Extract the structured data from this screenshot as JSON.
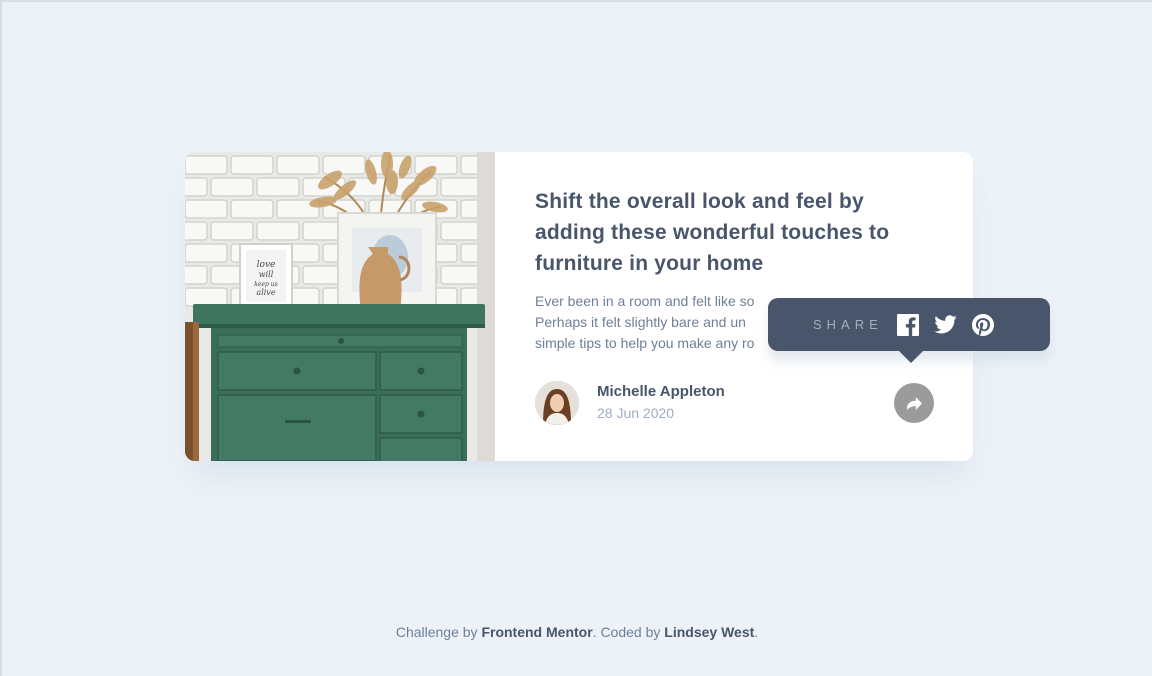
{
  "article": {
    "title": "Shift the overall look and feel by adding these wonderful touches to furniture in your home",
    "description": "Ever been in a room and felt like something was missing? Perhaps it felt slightly bare and uninviting. I’ve got some simple tips to help you make any room feel complete.",
    "description_visible": [
      "Ever been in a room and felt like so",
      "Perhaps it felt slightly bare and un",
      "simple tips to help you make any ro"
    ]
  },
  "author": {
    "name": "Michelle Appleton",
    "date": "28 Jun 2020"
  },
  "share": {
    "label": "SHARE",
    "networks": [
      "facebook-icon",
      "twitter-icon",
      "pinterest-icon"
    ]
  },
  "frame_text": {
    "love": "love",
    "will": "will",
    "keep": "keep us",
    "alive": "alive"
  },
  "attribution": {
    "prefix": "Challenge by ",
    "link1": "Frontend Mentor",
    "middle": ". Coded by ",
    "link2": "Lindsey West",
    "suffix": "."
  },
  "colors": {
    "background": "#ecf2f8",
    "dark": "#48556a",
    "muted": "#6e8098",
    "light": "#9eafc2",
    "share_button": "#9b9b9b"
  }
}
